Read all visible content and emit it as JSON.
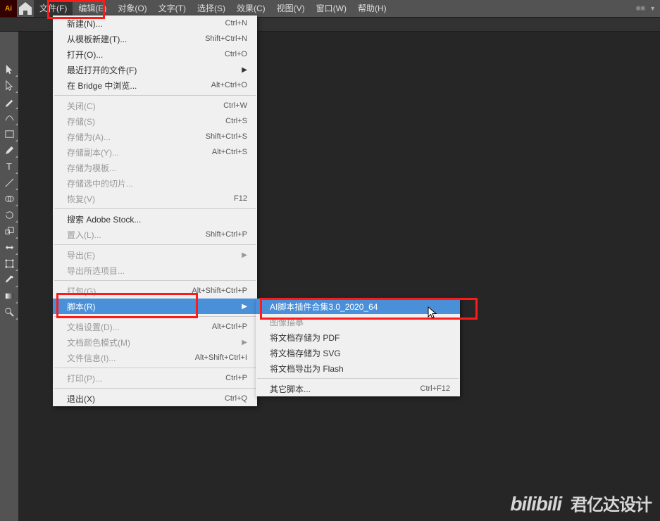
{
  "app_icon": "Ai",
  "menubar": [
    "文件(F)",
    "编辑(E)",
    "对象(O)",
    "文字(T)",
    "选择(S)",
    "效果(C)",
    "视图(V)",
    "窗口(W)",
    "帮助(H)"
  ],
  "toolbar_extra": {
    "blur": "■■",
    "drop": "▼"
  },
  "file_menu": [
    {
      "label": "新建(N)...",
      "shortcut": "Ctrl+N"
    },
    {
      "label": "从模板新建(T)...",
      "shortcut": "Shift+Ctrl+N"
    },
    {
      "label": "打开(O)...",
      "shortcut": "Ctrl+O"
    },
    {
      "label": "最近打开的文件(F)",
      "submenu": true
    },
    {
      "label": "在 Bridge 中浏览...",
      "shortcut": "Alt+Ctrl+O"
    },
    {
      "sep": true
    },
    {
      "label": "关闭(C)",
      "shortcut": "Ctrl+W",
      "disabled": true
    },
    {
      "label": "存储(S)",
      "shortcut": "Ctrl+S",
      "disabled": true
    },
    {
      "label": "存储为(A)...",
      "shortcut": "Shift+Ctrl+S",
      "disabled": true
    },
    {
      "label": "存储副本(Y)...",
      "shortcut": "Alt+Ctrl+S",
      "disabled": true
    },
    {
      "label": "存储为模板...",
      "disabled": true
    },
    {
      "label": "存储选中的切片...",
      "disabled": true
    },
    {
      "label": "恢复(V)",
      "shortcut": "F12",
      "disabled": true
    },
    {
      "sep": true
    },
    {
      "label": "搜索 Adobe Stock..."
    },
    {
      "label": "置入(L)...",
      "shortcut": "Shift+Ctrl+P",
      "disabled": true
    },
    {
      "sep": true
    },
    {
      "label": "导出(E)",
      "submenu": true,
      "disabled": true
    },
    {
      "label": "导出所选项目...",
      "disabled": true
    },
    {
      "sep": true
    },
    {
      "label": "打包(G)...",
      "shortcut": "Alt+Shift+Ctrl+P",
      "disabled": true
    },
    {
      "label": "脚本(R)",
      "submenu": true,
      "hi": true
    },
    {
      "sep": true
    },
    {
      "label": "文档设置(D)...",
      "shortcut": "Alt+Ctrl+P",
      "disabled": true
    },
    {
      "label": "文档颜色模式(M)",
      "submenu": true,
      "disabled": true
    },
    {
      "label": "文件信息(I)...",
      "shortcut": "Alt+Shift+Ctrl+I",
      "disabled": true
    },
    {
      "sep": true
    },
    {
      "label": "打印(P)...",
      "shortcut": "Ctrl+P",
      "disabled": true
    },
    {
      "sep": true
    },
    {
      "label": "退出(X)",
      "shortcut": "Ctrl+Q"
    }
  ],
  "script_submenu": [
    {
      "label": "AI脚本插件合集3.0_2020_64",
      "hi": true
    },
    {
      "label": "图像描摹",
      "disabled": true
    },
    {
      "label": "将文档存储为 PDF"
    },
    {
      "label": "将文档存储为 SVG"
    },
    {
      "label": "将文档导出为 Flash"
    },
    {
      "sep": true
    },
    {
      "label": "其它脚本...",
      "shortcut": "Ctrl+F12"
    }
  ],
  "watermark": {
    "latin": "bilibili",
    "cn": "君亿达设计"
  }
}
